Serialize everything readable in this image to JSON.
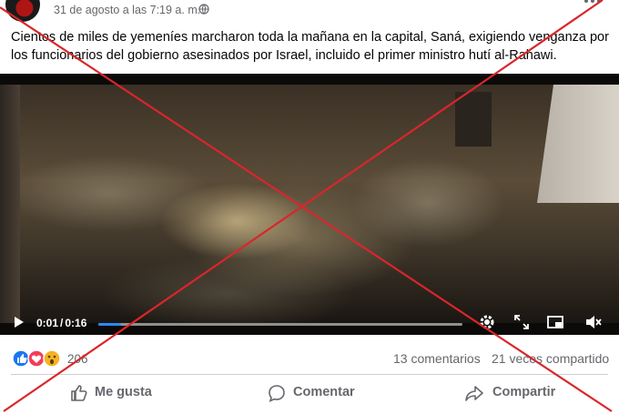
{
  "post": {
    "date": "31 de agosto a las 7:19 a. m.",
    "separator": "·",
    "privacy_icon": "globe-icon",
    "text": "Cientos de miles de yemeníes marcharon toda la mañana en la capital, Saná, exigiendo venganza por los funcionarios del gobierno asesinados por Israel, incluido el primer ministro hutí al-Rahawi."
  },
  "video": {
    "current_time": "0:01",
    "separator": "/",
    "duration": "0:16",
    "progress": 0.0625,
    "icons": [
      "play-icon",
      "settings-gear-icon",
      "fullscreen-icon",
      "picture-in-picture-icon",
      "mute-icon"
    ]
  },
  "engagement": {
    "reaction_icons": [
      "like-icon",
      "love-icon",
      "wow-icon"
    ],
    "reactions_count": "206",
    "comments": "13 comentarios",
    "shares": "21 veces compartido"
  },
  "actions": {
    "like_label": "Me gusta",
    "comment_label": "Comentar",
    "share_label": "Compartir"
  },
  "colors": {
    "overlay_cross": "#d9262c",
    "progress": "#2d88ff",
    "secondary_text": "#65676b"
  }
}
